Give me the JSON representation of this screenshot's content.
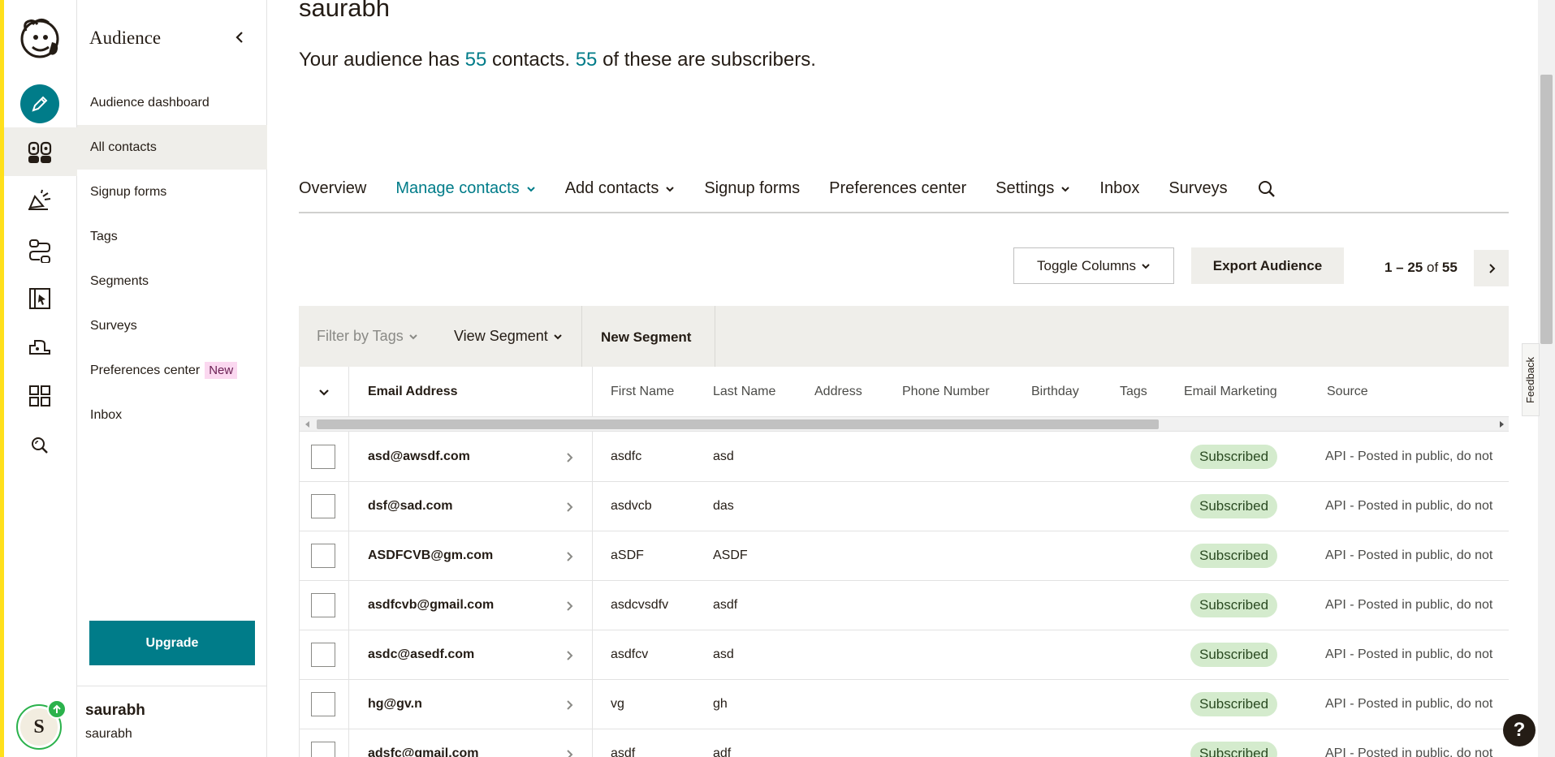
{
  "sidebar": {
    "title": "Audience",
    "items": [
      {
        "label": "Audience dashboard"
      },
      {
        "label": "All contacts"
      },
      {
        "label": "Signup forms"
      },
      {
        "label": "Tags"
      },
      {
        "label": "Segments"
      },
      {
        "label": "Surveys"
      },
      {
        "label": "Preferences center",
        "badge": "New"
      },
      {
        "label": "Inbox"
      }
    ],
    "upgrade_label": "Upgrade",
    "user": {
      "name": "saurabh",
      "sub": "saurabh",
      "initial": "S"
    }
  },
  "rail": {
    "icons": [
      "create-icon",
      "audience-icon",
      "campaigns-icon",
      "automations-icon",
      "website-icon",
      "integrations-icon",
      "content-icon",
      "search-icon"
    ]
  },
  "header": {
    "account_name": "saurabh",
    "summary": {
      "prefix": "Your audience has ",
      "contacts": "55",
      "middle": " contacts. ",
      "subscribers": "55",
      "suffix": " of these are subscribers."
    }
  },
  "tabs": [
    {
      "label": "Overview"
    },
    {
      "label": "Manage contacts"
    },
    {
      "label": "Add contacts"
    },
    {
      "label": "Signup forms"
    },
    {
      "label": "Preferences center"
    },
    {
      "label": "Settings"
    },
    {
      "label": "Inbox"
    },
    {
      "label": "Surveys"
    }
  ],
  "toolbar": {
    "toggle_columns": "Toggle Columns",
    "export": "Export Audience",
    "pager": {
      "range": "1 – 25",
      "of": "of",
      "total": "55"
    }
  },
  "filters": {
    "filter_tags": "Filter by Tags",
    "view_segment": "View Segment",
    "new_segment": "New Segment"
  },
  "table": {
    "columns": [
      "Email Address",
      "First Name",
      "Last Name",
      "Address",
      "Phone Number",
      "Birthday",
      "Tags",
      "Email Marketing",
      "Source"
    ],
    "rows": [
      {
        "email": "asd@awsdf.com",
        "first": "asdfc",
        "last": "asd",
        "status": "Subscribed",
        "source": "API - Posted in public, do not"
      },
      {
        "email": "dsf@sad.com",
        "first": "asdvcb",
        "last": "das",
        "status": "Subscribed",
        "source": "API - Posted in public, do not"
      },
      {
        "email": "ASDFCVB@gm.com",
        "first": "aSDF",
        "last": "ASDF",
        "status": "Subscribed",
        "source": "API - Posted in public, do not"
      },
      {
        "email": "asdfcvb@gmail.com",
        "first": "asdcvsdfv",
        "last": "asdf",
        "status": "Subscribed",
        "source": "API - Posted in public, do not"
      },
      {
        "email": "asdc@asedf.com",
        "first": "asdfcv",
        "last": "asd",
        "status": "Subscribed",
        "source": "API - Posted in public, do not"
      },
      {
        "email": "hg@gv.n",
        "first": "vg",
        "last": "gh",
        "status": "Subscribed",
        "source": "API - Posted in public, do not"
      },
      {
        "email": "adsfc@gmail.com",
        "first": "asdf",
        "last": "adf",
        "status": "Subscribed",
        "source": "API - Posted in public, do not"
      }
    ]
  },
  "feedback_label": "Feedback",
  "help_label": "?",
  "colors": {
    "brand": "#007c89",
    "yellow": "#ffe01b",
    "subscribed_bg": "#d4ebcd"
  }
}
